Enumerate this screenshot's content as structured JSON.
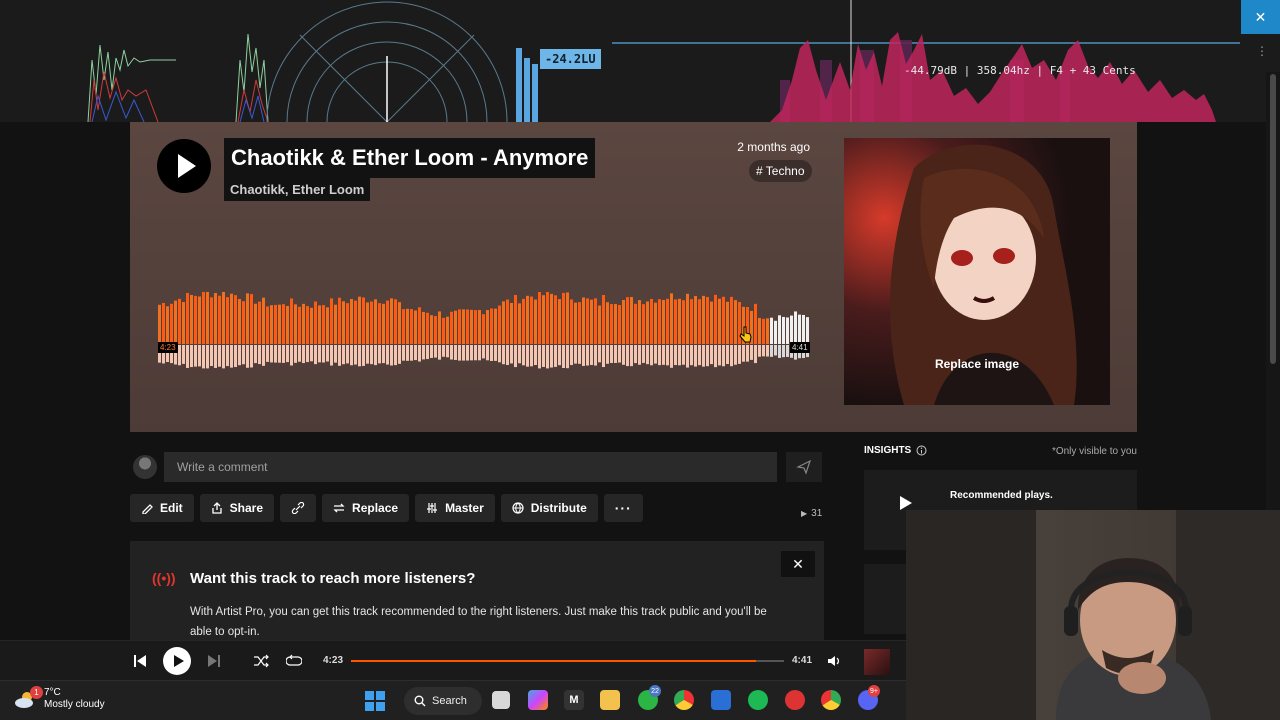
{
  "analyzer": {
    "loudness": "-24.2LU",
    "readout": "-44.79dB | 358.04hz | F4 + 43 Cents",
    "close_icon": "close-icon",
    "menu_icon": "kebab-icon"
  },
  "track": {
    "title": "Chaotikk & Ether Loom - Anymore",
    "artist": "Chaotikk, Ether Loom",
    "posted": "2 months ago",
    "genre": "# Techno",
    "time_elapsed": "4:23",
    "time_total": "4:41",
    "played_fraction": 0.936,
    "accent": "#ff5500"
  },
  "cover": {
    "replace_label": "Replace image"
  },
  "comment": {
    "placeholder": "Write a comment"
  },
  "actions": [
    {
      "label": "Edit",
      "icon": "pencil-icon"
    },
    {
      "label": "Share",
      "icon": "share-icon"
    },
    {
      "label": "",
      "icon": "link-icon"
    },
    {
      "label": "Replace",
      "icon": "replace-icon"
    },
    {
      "label": "Master",
      "icon": "sliders-icon"
    },
    {
      "label": "Distribute",
      "icon": "globe-icon"
    },
    {
      "label": "",
      "icon": "more-icon"
    }
  ],
  "plays": "31",
  "promo": {
    "title": "Want this track to reach more listeners?",
    "body": "With Artist Pro, you can get this track recommended to the right listeners. Just make this track public and you'll be able to opt-in."
  },
  "insights": {
    "title": "INSIGHTS",
    "note": "*Only visible to you",
    "card_title": "Recommended plays."
  },
  "player": {
    "current": "4:23",
    "duration": "4:41",
    "progress_fraction": 0.936
  },
  "taskbar": {
    "temperature": "7°C",
    "condition": "Mostly cloudy",
    "weather_badge": "1",
    "search_label": "Search",
    "whatsapp_badge": "22",
    "discord_badge": "9+"
  }
}
